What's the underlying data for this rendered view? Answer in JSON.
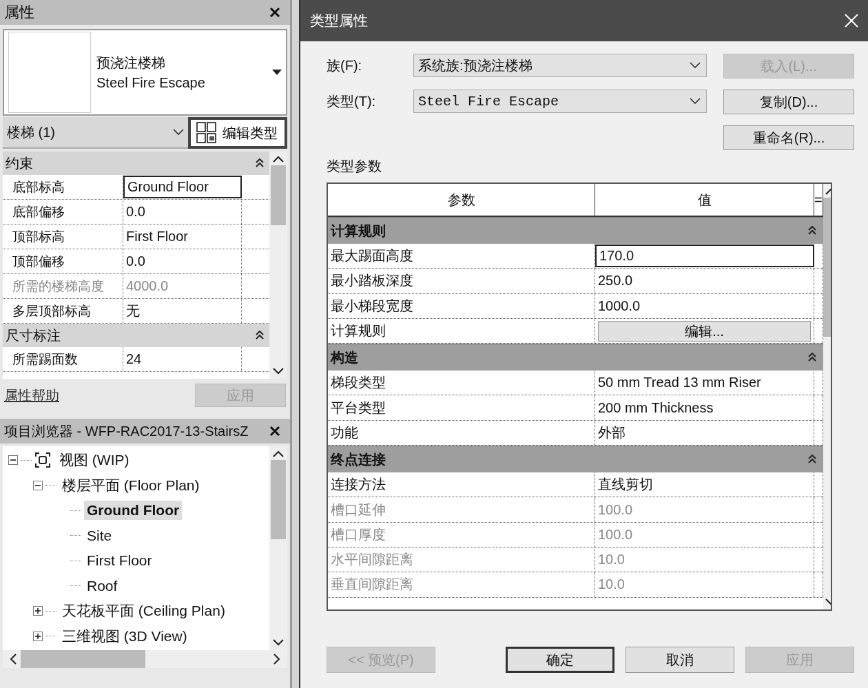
{
  "properties_panel": {
    "title": "属性",
    "type_selector": {
      "family": "预浇注楼梯",
      "type": "Steel Fire Escape"
    },
    "instance_filter": "楼梯 (1)",
    "edit_type_button": "编辑类型",
    "groups": [
      {
        "name": "约束",
        "expanded": true,
        "rows": [
          {
            "label": "底部标高",
            "value": "Ground Floor",
            "disabled": false,
            "editing": true
          },
          {
            "label": "底部偏移",
            "value": "0.0",
            "disabled": false,
            "editing": false
          },
          {
            "label": "顶部标高",
            "value": "First Floor",
            "disabled": false,
            "editing": false
          },
          {
            "label": "顶部偏移",
            "value": "0.0",
            "disabled": false,
            "editing": false
          },
          {
            "label": "所需的楼梯高度",
            "value": "4000.0",
            "disabled": true,
            "editing": false
          },
          {
            "label": "多层顶部标高",
            "value": "无",
            "disabled": false,
            "editing": false
          }
        ]
      },
      {
        "name": "尺寸标注",
        "expanded": true,
        "rows": [
          {
            "label": "所需踢面数",
            "value": "24",
            "disabled": false,
            "editing": false
          }
        ]
      }
    ],
    "help_link": "属性帮助",
    "apply_button": {
      "label": "应用",
      "disabled": true
    }
  },
  "project_browser": {
    "title": "项目浏览器 - WFP-RAC2017-13-StairsZ",
    "tree": [
      {
        "label": "视图 (WIP)",
        "expanded": true,
        "selected": false,
        "children": [
          {
            "label": "楼层平面 (Floor Plan)",
            "expanded": true,
            "selected": false,
            "children": [
              {
                "label": "Ground Floor",
                "selected": true
              },
              {
                "label": "Site",
                "selected": false
              },
              {
                "label": "First Floor",
                "selected": false
              },
              {
                "label": "Roof",
                "selected": false
              }
            ]
          },
          {
            "label": "天花板平面 (Ceiling Plan)",
            "expanded": false,
            "selected": false
          },
          {
            "label": "三维视图 (3D View)",
            "expanded": false,
            "selected": false
          }
        ]
      }
    ]
  },
  "dialog": {
    "title": "类型属性",
    "family": {
      "label": "族(F):",
      "value": "系统族:预浇注楼梯"
    },
    "type": {
      "label": "类型(T):",
      "value": "Steel Fire Escape"
    },
    "side_buttons": [
      {
        "label": "载入(L)...",
        "disabled": true
      },
      {
        "label": "复制(D)...",
        "disabled": false
      },
      {
        "label": "重命名(R)...",
        "disabled": false
      }
    ],
    "section_label": "类型参数",
    "columns": [
      "参数",
      "值",
      "="
    ],
    "groups": [
      {
        "name": "计算规则",
        "expanded": true,
        "rows": [
          {
            "kind": "text",
            "label": "最大踢面高度",
            "value": "170.0",
            "disabled": false,
            "editing": true
          },
          {
            "kind": "text",
            "label": "最小踏板深度",
            "value": "250.0",
            "disabled": false,
            "editing": false
          },
          {
            "kind": "text",
            "label": "最小梯段宽度",
            "value": "1000.0",
            "disabled": false,
            "editing": false
          },
          {
            "kind": "button",
            "label": "计算规则",
            "value": "编辑...",
            "disabled": false,
            "editing": false
          }
        ]
      },
      {
        "name": "构造",
        "expanded": true,
        "rows": [
          {
            "kind": "text",
            "label": "梯段类型",
            "value": "50 mm Tread 13 mm Riser",
            "disabled": false,
            "editing": false
          },
          {
            "kind": "text",
            "label": "平台类型",
            "value": "200 mm Thickness",
            "disabled": false,
            "editing": false
          },
          {
            "kind": "text",
            "label": "功能",
            "value": "外部",
            "disabled": false,
            "editing": false
          }
        ]
      },
      {
        "name": "终点连接",
        "expanded": true,
        "rows": [
          {
            "kind": "text",
            "label": "连接方法",
            "value": "直线剪切",
            "disabled": false,
            "editing": false
          },
          {
            "kind": "text",
            "label": "槽口延伸",
            "value": "100.0",
            "disabled": true,
            "editing": false
          },
          {
            "kind": "text",
            "label": "槽口厚度",
            "value": "100.0",
            "disabled": true,
            "editing": false
          },
          {
            "kind": "text",
            "label": "水平间隙距离",
            "value": "10.0",
            "disabled": true,
            "editing": false
          },
          {
            "kind": "text",
            "label": "垂直间隙距离",
            "value": "10.0",
            "disabled": true,
            "editing": false
          }
        ]
      }
    ],
    "footer_buttons": [
      {
        "label": "<< 预览(P)",
        "disabled": true,
        "default": false
      },
      {
        "label": "确定",
        "disabled": false,
        "default": true
      },
      {
        "label": "取消",
        "disabled": false,
        "default": false
      },
      {
        "label": "应用",
        "disabled": true,
        "default": false
      }
    ]
  }
}
